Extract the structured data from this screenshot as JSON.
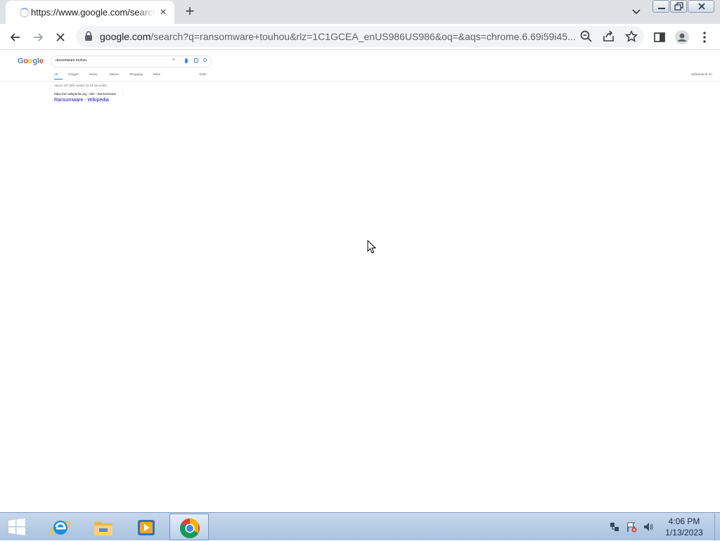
{
  "browser": {
    "tab": {
      "title": "https://www.google.com/search?q=ransomware+touhou",
      "close_glyph": "×"
    },
    "new_tab_glyph": "+",
    "omnibox": {
      "url_host": "google.com",
      "url_rest": "/search?q=ransomware+touhou&rlz=1C1GCEA_enUS986US986&oq=&aqs=chrome.6.69i59i45..."
    },
    "toolbar_icons": [
      "back-icon",
      "forward-icon",
      "stop-loading-icon",
      "lock-icon",
      "zoom-icon",
      "share-icon",
      "bookmark-star-icon",
      "side-panel-icon",
      "profile-icon",
      "menu-icon"
    ]
  },
  "google": {
    "logo": [
      "G",
      "o",
      "o",
      "g",
      "l",
      "e"
    ],
    "logo_colors": [
      "#4285f4",
      "#ea4335",
      "#fbbc05",
      "#4285f4",
      "#34a853",
      "#ea4335"
    ],
    "query": "ransomware touhou",
    "tabs": [
      "All",
      "Images",
      "News",
      "Videos",
      "Shopping",
      "More"
    ],
    "tools": "Tools",
    "safesearch": "SafeSearch on",
    "stats": "About 167,000 results (0.43 seconds)",
    "results": [
      {
        "cite": "https://en.wikipedia.org › wiki › Ransomware",
        "title": "Ransomware - Wikipedia"
      }
    ]
  },
  "taskbar": {
    "apps": [
      "internet-explorer-icon",
      "file-explorer-icon",
      "media-player-icon",
      "chrome-icon"
    ],
    "clock": {
      "time": "4:06 PM",
      "date": "1/13/2023"
    }
  }
}
